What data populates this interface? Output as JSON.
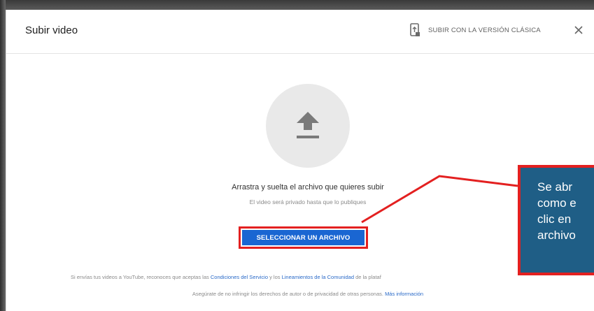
{
  "dialog": {
    "title": "Subir video",
    "classic_link_label": "SUBIR CON LA VERSIÓN CLÁSICA",
    "close_icon": "close-icon",
    "classic_icon": "phone-upload-icon"
  },
  "upload": {
    "icon": "upload-arrow-icon",
    "drag_text": "Arrastra y suelta el archivo que quieres subir",
    "private_text": "El video será privado hasta que lo publiques",
    "select_button": "SELECCIONAR UN ARCHIVO"
  },
  "terms": {
    "line1_pre": "Si envías tus videos a YouTube, reconoces que aceptas las ",
    "link_terms": "Condiciones del Servicio",
    "line1_mid": " y los ",
    "link_guidelines": "Lineamientos de la Comunidad",
    "line1_post": " de la plataf",
    "line2_pre": "Asegúrate de no infringir los derechos de autor o de privacidad de otras personas. ",
    "link_more": "Más información"
  },
  "callout": {
    "text": "Se abr\ncomo e\nclic en\narchivo",
    "box_color": "#1f5e86",
    "border_color": "#e32020"
  },
  "colors": {
    "accent_blue": "#1a66d2",
    "highlight_red": "#e32020",
    "link_blue": "#2a6ac8"
  }
}
